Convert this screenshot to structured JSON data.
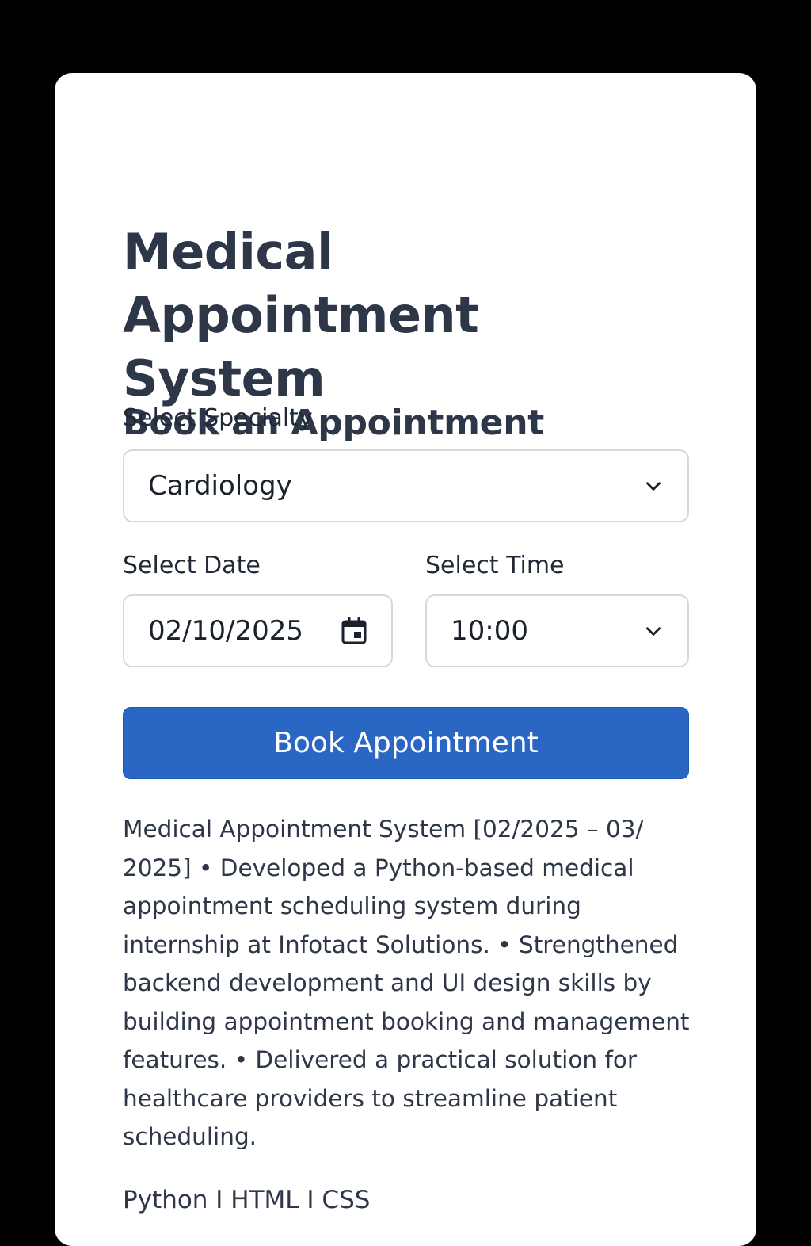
{
  "page": {
    "title": "Medical Appointment System",
    "section_title": "Book an Appointment"
  },
  "form": {
    "specialty": {
      "label": "Select Specialty",
      "value": "Cardiology"
    },
    "date": {
      "label": "Select Date",
      "value": "02/10/2025"
    },
    "time": {
      "label": "Select Time",
      "value": "10:00"
    },
    "submit_label": "Book Appointment"
  },
  "description": "Medical Appointment System [02/2025 – 03/ 2025] • Developed a Python-based medical appointment scheduling system during internship at Infotact Solutions. • Strengthened backend development and UI design skills by building appointment booking and management features. • Delivered a practical solution for healthcare providers to streamline patient scheduling.",
  "tech_stack": "Python I HTML I CSS",
  "colors": {
    "primary_button": "#2a67c4",
    "heading_text": "#2d3748",
    "background": "#000000",
    "card": "#ffffff"
  },
  "icons": {
    "specialty_dropdown": "chevron-down-icon",
    "date_picker": "calendar-icon",
    "time_dropdown": "chevron-down-icon"
  }
}
